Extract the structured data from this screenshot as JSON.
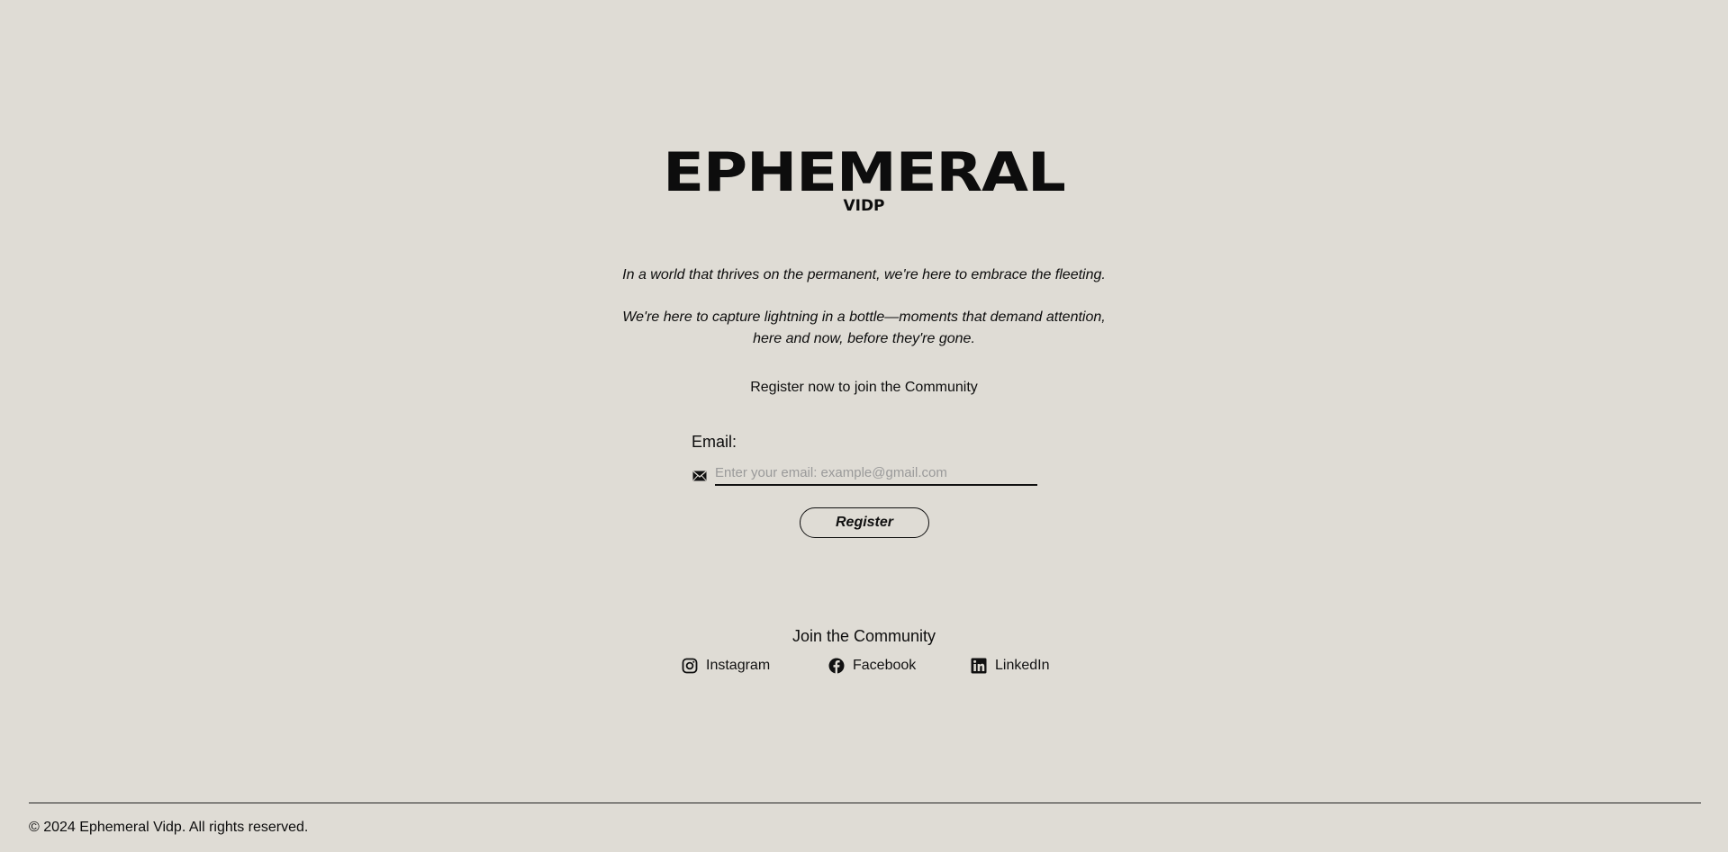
{
  "logo": {
    "title": "EPHEMERAL",
    "subtitle": "VIDP"
  },
  "intro": {
    "line1": "In a world that thrives on the permanent, we're here to embrace the fleeting.",
    "line2a": "We're here to capture lightning in a bottle—moments that demand attention,",
    "line2b": "here and now, before they're gone."
  },
  "register_form": {
    "prompt": "Register now to join the Community",
    "email_label": "Email:",
    "email_placeholder": "Enter your email: example@gmail.com",
    "email_value": "",
    "button_label": "Register"
  },
  "community": {
    "title": "Join the Community",
    "links": [
      {
        "label": "Instagram",
        "icon": "instagram-icon"
      },
      {
        "label": "Facebook",
        "icon": "facebook-icon"
      },
      {
        "label": "LinkedIn",
        "icon": "linkedin-icon"
      }
    ]
  },
  "footer": {
    "copyright": "© 2024 Ephemeral Vidp. All rights reserved."
  },
  "colors": {
    "background": "#dfdcd5",
    "text": "#0d0d0d",
    "placeholder": "#9a9a9a"
  }
}
